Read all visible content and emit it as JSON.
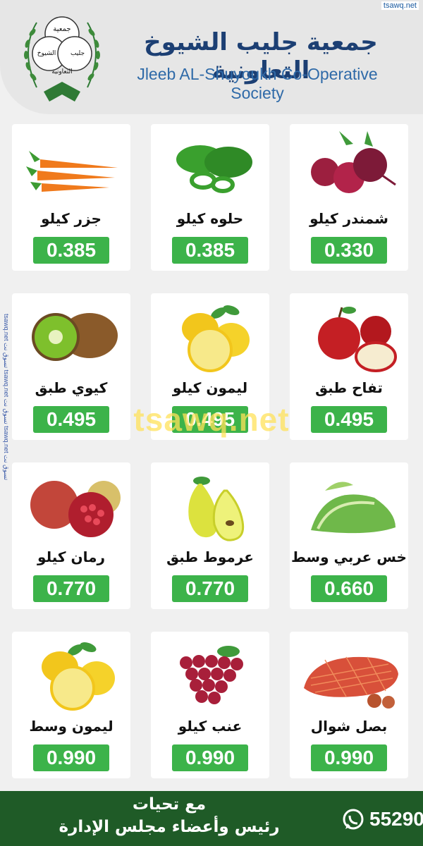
{
  "header": {
    "logo_text": [
      "جمعية",
      "جليب",
      "الشيوخ",
      "التعاونية"
    ],
    "title_ar": "جمعية جليب الشيوخ التعاونية",
    "title_en": "Jleeb AL-Shuyoukh Co-Operative Society",
    "site_badge": "tsawq.net"
  },
  "side_mark": "tsawq.net تسوق نت tsawq.net تسوق نت tsawq.net تسوق نت",
  "watermark": "tsawq.net",
  "products": [
    {
      "name": "جزر كيلو",
      "price": "0.385",
      "icon": "carrot-icon"
    },
    {
      "name": "حلوه كيلو",
      "price": "0.385",
      "icon": "green-pepper-icon"
    },
    {
      "name": "شمندر كيلو",
      "price": "0.330",
      "icon": "beetroot-icon"
    },
    {
      "name": "كيوي طبق",
      "price": "0.495",
      "icon": "kiwi-icon"
    },
    {
      "name": "ليمون كيلو",
      "price": "0.495",
      "icon": "lemon-icon"
    },
    {
      "name": "تفاح طبق",
      "price": "0.495",
      "icon": "apple-icon"
    },
    {
      "name": "رمان كيلو",
      "price": "0.770",
      "icon": "pomegranate-icon"
    },
    {
      "name": "عرموط طبق",
      "price": "0.770",
      "icon": "pear-icon"
    },
    {
      "name": "خس عربي وسط",
      "price": "0.660",
      "icon": "lettuce-icon"
    },
    {
      "name": "ليمون وسط",
      "price": "0.990",
      "icon": "lemon-icon"
    },
    {
      "name": "عنب كيلو",
      "price": "0.990",
      "icon": "grapes-icon"
    },
    {
      "name": "بصل شوال",
      "price": "0.990",
      "icon": "onion-sack-icon"
    }
  ],
  "footer": {
    "line1": "مع تحيات",
    "line2": "رئيس وأعضاء مجلس الإدارة",
    "phone": "55290"
  },
  "colors": {
    "price_green": "#3cb34a",
    "footer_green": "#1f5b27",
    "title_blue": "#1c3f73"
  }
}
